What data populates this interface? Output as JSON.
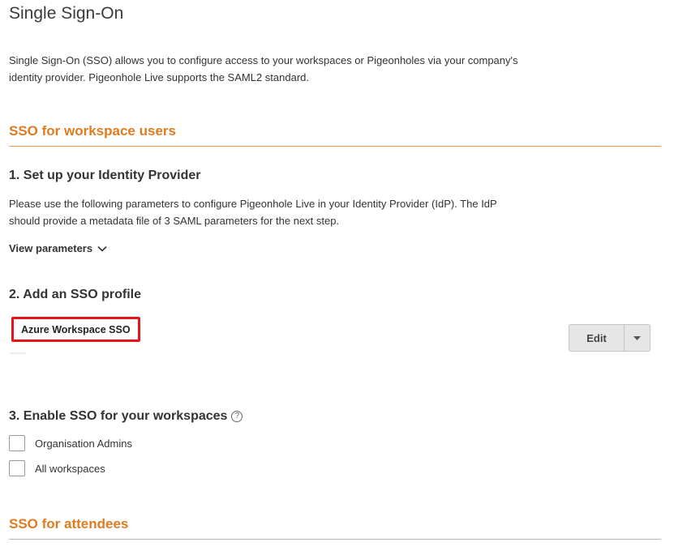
{
  "page": {
    "title": "Single Sign-On",
    "intro_line1": "Single Sign-On (SSO) allows you to configure access to your workspaces or Pigeonholes via your company's",
    "intro_line2": "identity provider. Pigeonhole Live supports the SAML2 standard."
  },
  "workspace_section": {
    "heading": "SSO for workspace users",
    "step1": {
      "heading": "1. Set up your Identity Provider",
      "desc_line1": "Please use the following parameters to configure Pigeonhole Live in your Identity Provider (IdP). The IdP",
      "desc_line2": "should provide a metadata file of 3 SAML parameters for the next step.",
      "view_params_label": "View parameters",
      "view_params_icon": "chevron-down-icon"
    },
    "step2": {
      "heading": "2. Add an SSO profile",
      "profile_name": "Azure Workspace SSO",
      "edit_label": "Edit",
      "caret_icon": "caret-down-icon"
    },
    "step3": {
      "heading": "3. Enable SSO for your workspaces",
      "help_icon": "question-circle-icon",
      "help_glyph": "?",
      "options": [
        {
          "label": "Organisation Admins",
          "checked": false
        },
        {
          "label": "All workspaces",
          "checked": false
        }
      ]
    }
  },
  "attendees_section": {
    "heading": "SSO for attendees"
  },
  "colors": {
    "accent": "#e07b20",
    "highlight_border": "#e8141b",
    "button_bg": "#e6e6e6"
  }
}
